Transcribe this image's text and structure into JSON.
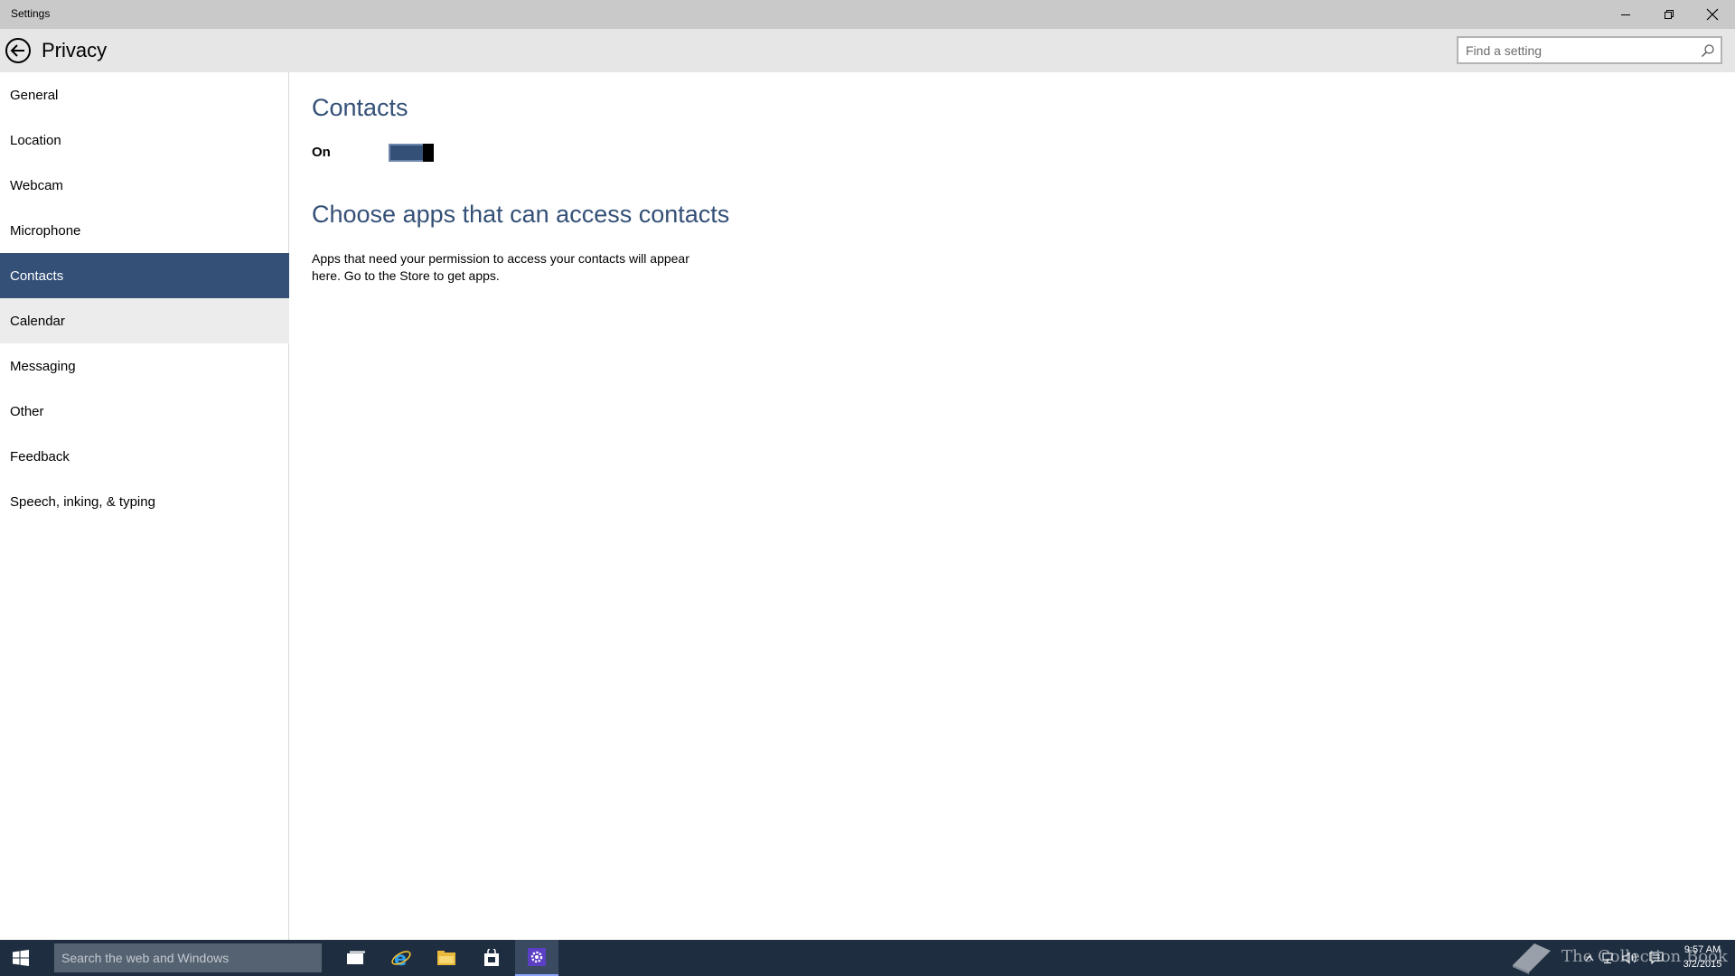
{
  "window": {
    "title": "Settings",
    "minimize_icon": "minimize-icon",
    "maximize_icon": "restore-icon",
    "close_icon": "close-icon"
  },
  "header": {
    "back_icon": "back-arrow-icon",
    "page_title": "Privacy",
    "search": {
      "placeholder": "Find a setting",
      "value": "",
      "icon": "search-icon"
    }
  },
  "sidebar": {
    "items": [
      {
        "label": "General"
      },
      {
        "label": "Location"
      },
      {
        "label": "Webcam"
      },
      {
        "label": "Microphone"
      },
      {
        "label": "Contacts",
        "state": "selected"
      },
      {
        "label": "Calendar",
        "state": "hover"
      },
      {
        "label": "Messaging"
      },
      {
        "label": "Other"
      },
      {
        "label": "Feedback"
      },
      {
        "label": "Speech, inking, & typing"
      }
    ]
  },
  "main": {
    "title": "Contacts",
    "toggle": {
      "label": "On",
      "state": "on"
    },
    "section_heading": "Choose apps that can access contacts",
    "section_desc_line1": "Apps that need your permission to access your contacts will appear",
    "section_desc_line2": "here. Go to the Store to get apps."
  },
  "taskbar": {
    "start_icon": "windows-logo-icon",
    "search_placeholder": "Search the web and Windows",
    "apps": [
      {
        "name": "task-view-icon"
      },
      {
        "name": "internet-explorer-icon"
      },
      {
        "name": "file-explorer-icon"
      },
      {
        "name": "store-icon"
      },
      {
        "name": "settings-gear-icon",
        "state": "active"
      }
    ],
    "tray_icons": [
      "show-hidden-icons-icon",
      "network-icon",
      "volume-icon",
      "action-center-icon"
    ],
    "watermark_text": "The Collection Book",
    "time": "9:57 AM",
    "date": "3/2/2015"
  },
  "colors": {
    "accent": "#345077",
    "titlebar": "#c9c9c9",
    "header": "#e6e6e6",
    "taskbar": "#1e2d40"
  }
}
